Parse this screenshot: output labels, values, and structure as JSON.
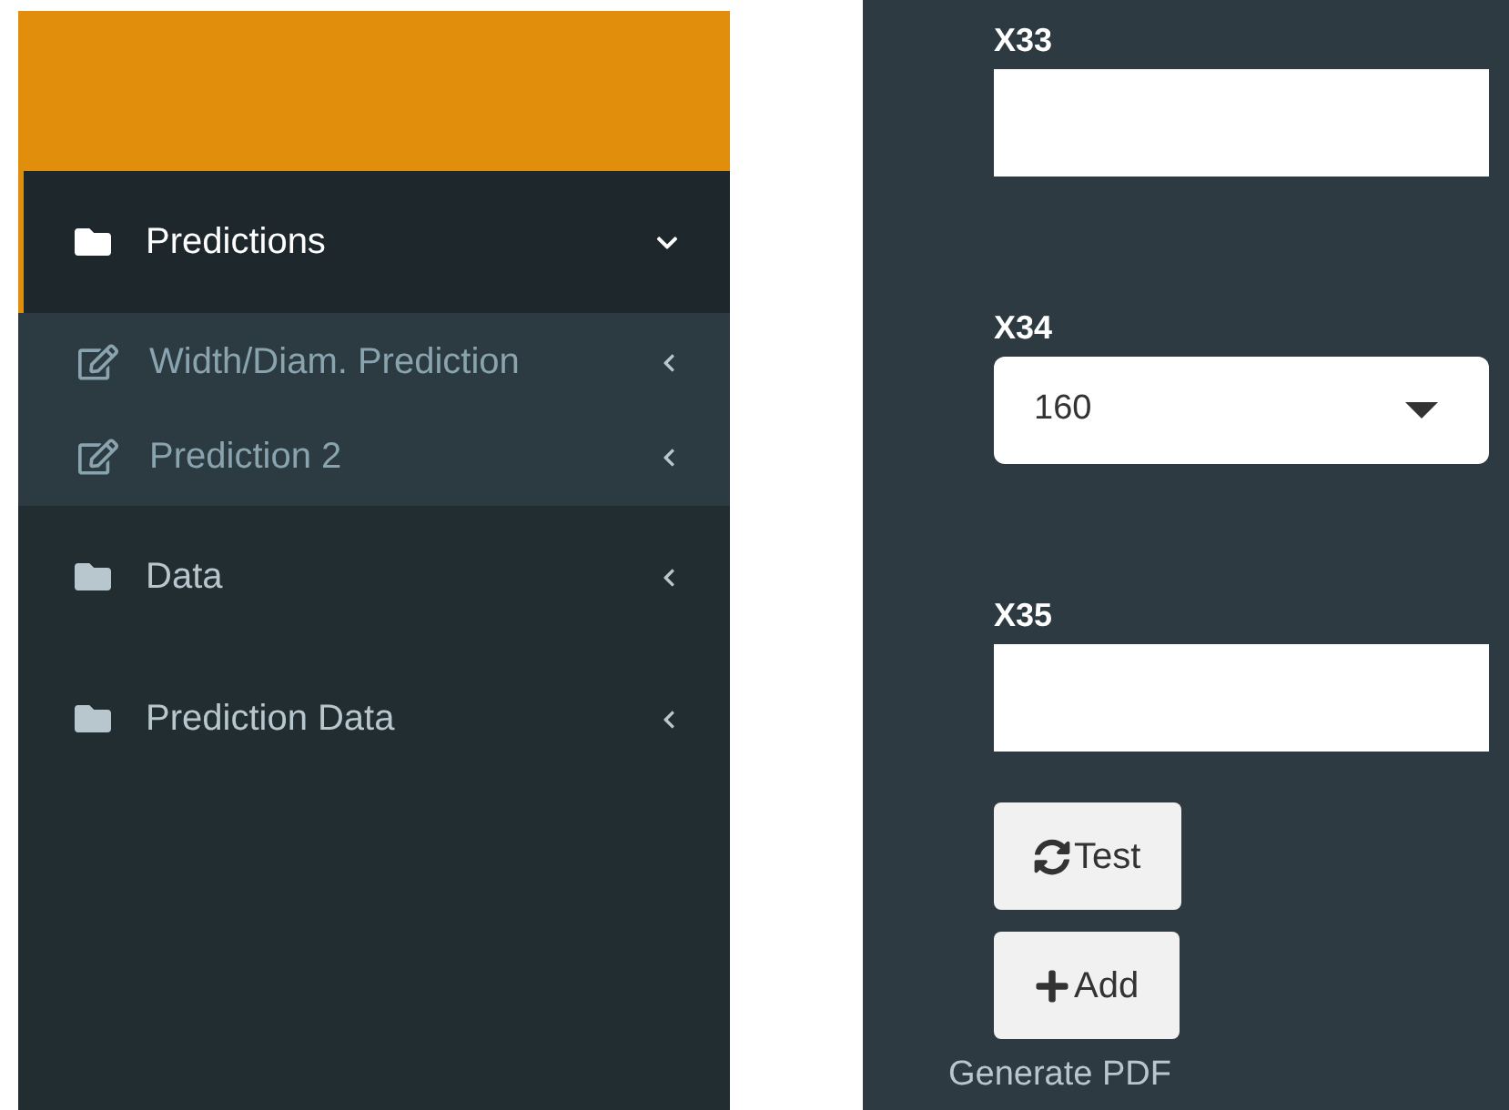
{
  "sidebar": {
    "items": [
      {
        "label": "Predictions",
        "selected": true,
        "expanded": true,
        "children": [
          {
            "label": "Width/Diam. Prediction",
            "expanded": false
          },
          {
            "label": "Prediction 2",
            "expanded": false
          }
        ]
      },
      {
        "label": "Data",
        "selected": false,
        "expanded": false
      },
      {
        "label": "Prediction Data",
        "selected": false,
        "expanded": false
      }
    ]
  },
  "form": {
    "fields": [
      {
        "kind": "text",
        "label": "X33"
      },
      {
        "kind": "select",
        "label": "X34",
        "value": "160"
      },
      {
        "kind": "text",
        "label": "X35"
      }
    ],
    "buttons": [
      {
        "kind": "refresh",
        "label": "Test"
      },
      {
        "kind": "plus",
        "label": "Add"
      }
    ],
    "link": "Generate PDF"
  }
}
